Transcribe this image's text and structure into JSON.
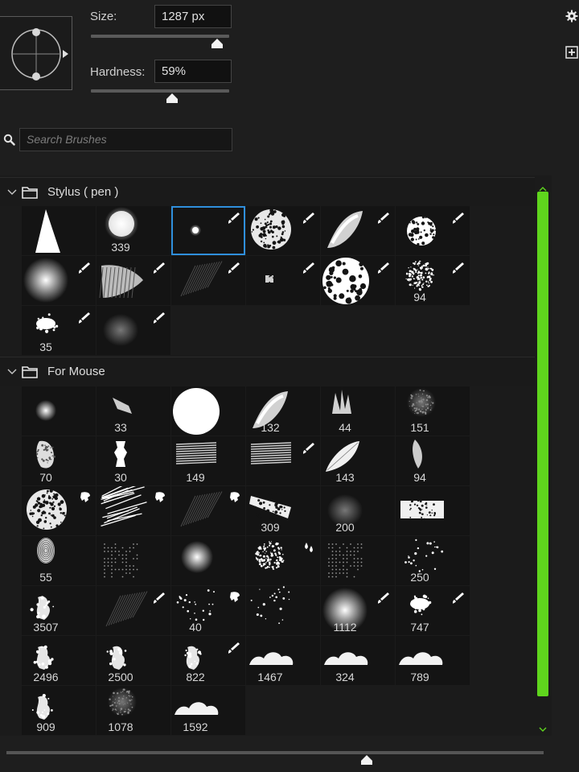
{
  "brush": {
    "size_label": "Size:",
    "size_value": "1287 px",
    "size_level": 0.91,
    "hardness_label": "Hardness:",
    "hardness_value": "59%",
    "hardness_level": 0.59
  },
  "side_icons": [
    "gear-icon",
    "add-panel-icon"
  ],
  "search": {
    "placeholder": "Search Brushes"
  },
  "groups": [
    {
      "name": "Stylus ( pen )",
      "brushes": [
        {
          "shape": "cone",
          "num": ""
        },
        {
          "shape": "round-soft",
          "num": "339"
        },
        {
          "shape": "dot",
          "num": "",
          "tool": "brush",
          "selected": true
        },
        {
          "shape": "speckle-round",
          "num": "",
          "tool": "brush"
        },
        {
          "shape": "streak",
          "num": "",
          "tool": "brush"
        },
        {
          "shape": "speckle-small",
          "num": "",
          "tool": "brush"
        },
        {
          "shape": "soft-blur",
          "num": "",
          "tool": "brush"
        },
        {
          "shape": "hatch",
          "num": "",
          "tool": "brush"
        },
        {
          "shape": "faint-lines",
          "num": "",
          "tool": "brush"
        },
        {
          "shape": "tiny",
          "num": "",
          "tool": "brush"
        },
        {
          "shape": "spot-big",
          "num": "",
          "tool": "brush"
        },
        {
          "shape": "noise-cloud",
          "num": "94",
          "tool": "brush"
        },
        {
          "shape": "splat",
          "num": "35",
          "tool": "brush"
        },
        {
          "shape": "faint-square",
          "num": "",
          "tool": "brush"
        }
      ]
    },
    {
      "name": "For Mouse",
      "brushes": [
        {
          "shape": "soft-small",
          "num": ""
        },
        {
          "shape": "shard",
          "num": "33"
        },
        {
          "shape": "hard-big",
          "num": ""
        },
        {
          "shape": "streak",
          "num": "132"
        },
        {
          "shape": "grass",
          "num": "44"
        },
        {
          "shape": "dim-round",
          "num": "151"
        },
        {
          "shape": "smudge",
          "num": "70"
        },
        {
          "shape": "bar",
          "num": "30"
        },
        {
          "shape": "hatch-lines",
          "num": "149"
        },
        {
          "shape": "hatch-lines",
          "num": "",
          "tool": "brush"
        },
        {
          "shape": "feather",
          "num": "143"
        },
        {
          "shape": "leaf",
          "num": "94"
        },
        {
          "shape": "speckle-round",
          "num": "",
          "tool": "smudge"
        },
        {
          "shape": "scratch",
          "num": "",
          "tool": "smudge"
        },
        {
          "shape": "faint-lines",
          "num": "",
          "tool": "smudge"
        },
        {
          "shape": "dry-stroke",
          "num": "309"
        },
        {
          "shape": "faint-square",
          "num": "200"
        },
        {
          "shape": "rect-texture",
          "num": ""
        },
        {
          "shape": "fingerprint",
          "num": "55"
        },
        {
          "shape": "dot-grid",
          "num": ""
        },
        {
          "shape": "cloud-soft",
          "num": ""
        },
        {
          "shape": "noise-cloud",
          "num": "",
          "tool": "drops"
        },
        {
          "shape": "dot-grid",
          "num": ""
        },
        {
          "shape": "scatter",
          "num": "250"
        },
        {
          "shape": "smoke",
          "num": "3507"
        },
        {
          "shape": "faint-lines",
          "num": "",
          "tool": "brush"
        },
        {
          "shape": "scatter",
          "num": "40",
          "tool": "smudge"
        },
        {
          "shape": "scatter",
          "num": ""
        },
        {
          "shape": "soft-blur",
          "num": "1112",
          "tool": "brush"
        },
        {
          "shape": "splat",
          "num": "747",
          "tool": "brush"
        },
        {
          "shape": "smoke",
          "num": "2496"
        },
        {
          "shape": "smoke",
          "num": "2500"
        },
        {
          "shape": "smoke",
          "num": "822",
          "tool": "brush"
        },
        {
          "shape": "cloud",
          "num": "1467"
        },
        {
          "shape": "cloud",
          "num": "324"
        },
        {
          "shape": "cloud",
          "num": "789"
        },
        {
          "shape": "smoke",
          "num": "909"
        },
        {
          "shape": "dim-round",
          "num": "1078"
        },
        {
          "shape": "cloud",
          "num": "1592"
        }
      ]
    }
  ],
  "bottom_slider_level": 0.67
}
